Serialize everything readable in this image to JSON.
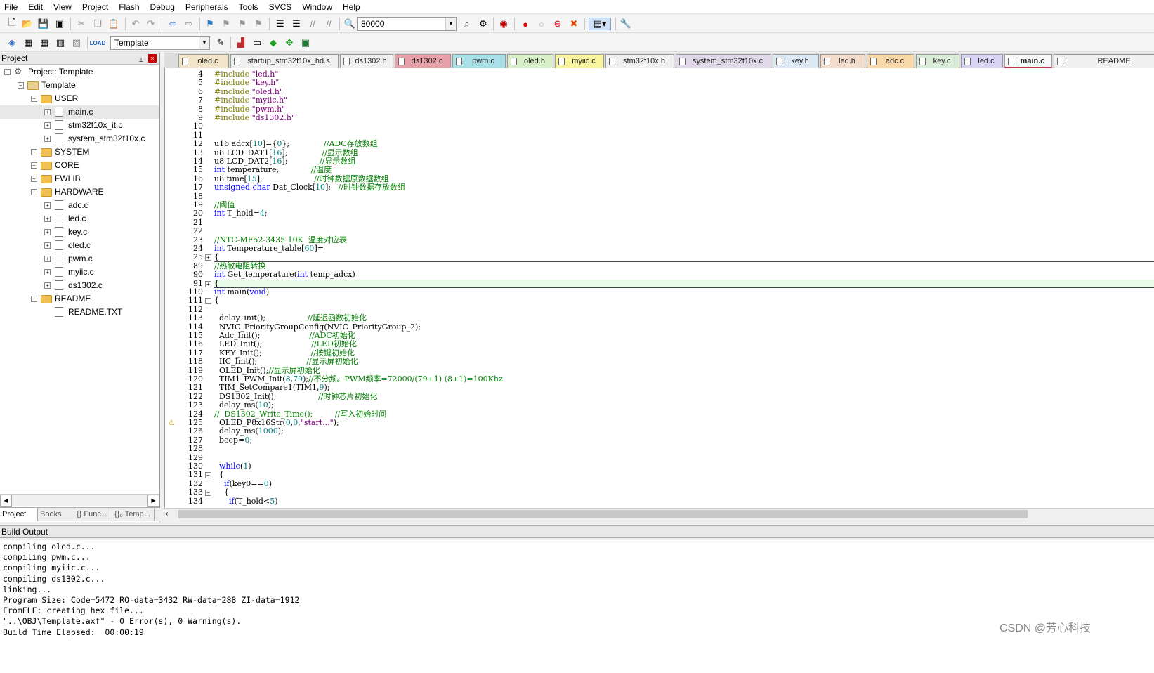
{
  "menu": [
    "File",
    "Edit",
    "View",
    "Project",
    "Flash",
    "Debug",
    "Peripherals",
    "Tools",
    "SVCS",
    "Window",
    "Help"
  ],
  "toolbar": {
    "find_value": "80000",
    "target": "Template"
  },
  "project_panel": {
    "title": "Project",
    "pin": "⊥",
    "close": "×",
    "tree": [
      {
        "label": "Project: Template",
        "depth": 0,
        "exp": "−",
        "kind": "proj"
      },
      {
        "label": "Template",
        "depth": 1,
        "exp": "−",
        "kind": "target"
      },
      {
        "label": "USER",
        "depth": 2,
        "exp": "−",
        "kind": "folder"
      },
      {
        "label": "main.c",
        "depth": 3,
        "exp": "+",
        "kind": "file",
        "sel": true
      },
      {
        "label": "stm32f10x_it.c",
        "depth": 3,
        "exp": "+",
        "kind": "file"
      },
      {
        "label": "system_stm32f10x.c",
        "depth": 3,
        "exp": "+",
        "kind": "file"
      },
      {
        "label": "SYSTEM",
        "depth": 2,
        "exp": "+",
        "kind": "folder"
      },
      {
        "label": "CORE",
        "depth": 2,
        "exp": "+",
        "kind": "folder"
      },
      {
        "label": "FWLIB",
        "depth": 2,
        "exp": "+",
        "kind": "folder"
      },
      {
        "label": "HARDWARE",
        "depth": 2,
        "exp": "−",
        "kind": "folder"
      },
      {
        "label": "adc.c",
        "depth": 3,
        "exp": "+",
        "kind": "file"
      },
      {
        "label": "led.c",
        "depth": 3,
        "exp": "+",
        "kind": "file"
      },
      {
        "label": "key.c",
        "depth": 3,
        "exp": "+",
        "kind": "file"
      },
      {
        "label": "oled.c",
        "depth": 3,
        "exp": "+",
        "kind": "file"
      },
      {
        "label": "pwm.c",
        "depth": 3,
        "exp": "+",
        "kind": "file"
      },
      {
        "label": "myiic.c",
        "depth": 3,
        "exp": "+",
        "kind": "file"
      },
      {
        "label": "ds1302.c",
        "depth": 3,
        "exp": "+",
        "kind": "file"
      },
      {
        "label": "README",
        "depth": 2,
        "exp": "−",
        "kind": "folder"
      },
      {
        "label": "README.TXT",
        "depth": 3,
        "exp": "",
        "kind": "file"
      }
    ],
    "bottom_tabs": [
      "Project",
      "Books",
      "{} Func...",
      "{}₀ Temp..."
    ]
  },
  "tabs": [
    {
      "label": "oled.c",
      "color": "#f2e4c8"
    },
    {
      "label": "startup_stm32f10x_hd.s",
      "color": "#f0f0f0"
    },
    {
      "label": "ds1302.h",
      "color": "#f0f0f0"
    },
    {
      "label": "ds1302.c",
      "color": "#e8a0a8"
    },
    {
      "label": "pwm.c",
      "color": "#a8e0e8"
    },
    {
      "label": "oled.h",
      "color": "#d8f0c8"
    },
    {
      "label": "myiic.c",
      "color": "#f8f4a0"
    },
    {
      "label": "stm32f10x.h",
      "color": "#f0f0f0"
    },
    {
      "label": "system_stm32f10x.c",
      "color": "#e0d8e8"
    },
    {
      "label": "key.h",
      "color": "#dce8f4"
    },
    {
      "label": "led.h",
      "color": "#f4dccc"
    },
    {
      "label": "adc.c",
      "color": "#f8d8a8"
    },
    {
      "label": "key.c",
      "color": "#d8ecd8"
    },
    {
      "label": "led.c",
      "color": "#d8d4f4"
    },
    {
      "label": "main.c",
      "color": "#f8f8f8",
      "active": true
    },
    {
      "label": "README",
      "color": "#f0f0f0"
    }
  ],
  "code": [
    {
      "ln": "4",
      "segs": [
        [
          "pp",
          "#include "
        ],
        [
          "st",
          "\"led.h\""
        ]
      ]
    },
    {
      "ln": "5",
      "segs": [
        [
          "pp",
          "#include "
        ],
        [
          "st",
          "\"key.h\""
        ]
      ]
    },
    {
      "ln": "6",
      "segs": [
        [
          "pp",
          "#include "
        ],
        [
          "st",
          "\"oled.h\""
        ]
      ]
    },
    {
      "ln": "7",
      "segs": [
        [
          "pp",
          "#include "
        ],
        [
          "st",
          "\"myiic.h\""
        ]
      ]
    },
    {
      "ln": "8",
      "segs": [
        [
          "pp",
          "#include "
        ],
        [
          "st",
          "\"pwm.h\""
        ]
      ]
    },
    {
      "ln": "9",
      "segs": [
        [
          "pp",
          "#include "
        ],
        [
          "st",
          "\"ds1302.h\""
        ]
      ]
    },
    {
      "ln": "10",
      "segs": []
    },
    {
      "ln": "11",
      "segs": []
    },
    {
      "ln": "12",
      "segs": [
        [
          "",
          "u16 adcx["
        ],
        [
          "nm",
          "10"
        ],
        [
          "",
          "]={"
        ],
        [
          "nm",
          "0"
        ],
        [
          "",
          "};              "
        ],
        [
          "cm",
          "//ADC存放数组"
        ]
      ]
    },
    {
      "ln": "13",
      "segs": [
        [
          "",
          "u8 LCD_DAT1["
        ],
        [
          "nm",
          "16"
        ],
        [
          "",
          "];              "
        ],
        [
          "cm",
          "//显示数组"
        ]
      ]
    },
    {
      "ln": "14",
      "segs": [
        [
          "",
          "u8 LCD_DAT2["
        ],
        [
          "nm",
          "16"
        ],
        [
          "",
          "];             "
        ],
        [
          "cm",
          "//显示数组"
        ]
      ]
    },
    {
      "ln": "15",
      "segs": [
        [
          "kw",
          "int"
        ],
        [
          "",
          " temperature;             "
        ],
        [
          "cm",
          "//温度"
        ]
      ]
    },
    {
      "ln": "16",
      "segs": [
        [
          "",
          "u8 time["
        ],
        [
          "nm",
          "15"
        ],
        [
          "",
          "];                     "
        ],
        [
          "cm",
          "//时钟数据原数据数组"
        ]
      ]
    },
    {
      "ln": "17",
      "segs": [
        [
          "kw",
          "unsigned"
        ],
        [
          "",
          " "
        ],
        [
          "kw",
          "char"
        ],
        [
          "",
          " Dat_Clock["
        ],
        [
          "nm",
          "10"
        ],
        [
          "",
          "];   "
        ],
        [
          "cm",
          "//时钟数据存放数组"
        ]
      ]
    },
    {
      "ln": "18",
      "segs": []
    },
    {
      "ln": "19",
      "segs": [
        [
          "cm",
          "//阈值"
        ]
      ]
    },
    {
      "ln": "20",
      "segs": [
        [
          "kw",
          "int"
        ],
        [
          "",
          " T_hold="
        ],
        [
          "nm",
          "4"
        ],
        [
          "",
          ";"
        ]
      ]
    },
    {
      "ln": "21",
      "segs": []
    },
    {
      "ln": "22",
      "segs": []
    },
    {
      "ln": "23",
      "segs": [
        [
          "cm",
          "//NTC-MF52-3435 10K  温度对应表"
        ]
      ]
    },
    {
      "ln": "24",
      "segs": [
        [
          "kw",
          "int"
        ],
        [
          "",
          " Temperature_table["
        ],
        [
          "nm",
          "60"
        ],
        [
          "",
          "]="
        ]
      ]
    },
    {
      "ln": "25",
      "segs": [
        [
          "",
          "{"
        ]
      ],
      "fold": "+",
      "box": true
    },
    {
      "ln": "89",
      "segs": [
        [
          "cm",
          "//热敏电阻转换"
        ]
      ]
    },
    {
      "ln": "90",
      "segs": [
        [
          "kw",
          "int"
        ],
        [
          "",
          " Get_temperature("
        ],
        [
          "kw",
          "int"
        ],
        [
          "",
          " temp_adcx)"
        ]
      ]
    },
    {
      "ln": "91",
      "segs": [
        [
          "",
          "{"
        ]
      ],
      "fold": "+",
      "box": true,
      "cur": true
    },
    {
      "ln": "110",
      "segs": [
        [
          "kw",
          "int"
        ],
        [
          "",
          " main("
        ],
        [
          "kw",
          "void"
        ],
        [
          "",
          ")"
        ]
      ]
    },
    {
      "ln": "111",
      "segs": [
        [
          "",
          "{"
        ]
      ],
      "fold": "−"
    },
    {
      "ln": "112",
      "segs": []
    },
    {
      "ln": "113",
      "segs": [
        [
          "",
          "  delay_init();                 "
        ],
        [
          "cm",
          "//延迟函数初始化"
        ]
      ]
    },
    {
      "ln": "114",
      "segs": [
        [
          "",
          "  NVIC_PriorityGroupConfig(NVIC_PriorityGroup_2);"
        ]
      ]
    },
    {
      "ln": "115",
      "segs": [
        [
          "",
          "  Adc_Init();                    "
        ],
        [
          "cm",
          "//ADC初始化"
        ]
      ]
    },
    {
      "ln": "116",
      "segs": [
        [
          "",
          "  LED_Init();                    "
        ],
        [
          "cm",
          "//LED初始化"
        ]
      ]
    },
    {
      "ln": "117",
      "segs": [
        [
          "",
          "  KEY_Init();                    "
        ],
        [
          "cm",
          "//按键初始化"
        ]
      ]
    },
    {
      "ln": "118",
      "segs": [
        [
          "",
          "  IIC_Init();                    "
        ],
        [
          "cm",
          "//显示屏初始化"
        ]
      ]
    },
    {
      "ln": "119",
      "segs": [
        [
          "",
          "  OLED_Init();"
        ],
        [
          "cm",
          "//显示屏初始化"
        ]
      ]
    },
    {
      "ln": "120",
      "segs": [
        [
          "",
          "  TIM1_PWM_Init("
        ],
        [
          "nm",
          "8"
        ],
        [
          "",
          ","
        ],
        [
          "nm",
          "79"
        ],
        [
          "",
          ");"
        ],
        [
          "cm",
          "//不分频。PWM频率=72000/(79+1) (8+1)=100Khz"
        ]
      ]
    },
    {
      "ln": "121",
      "segs": [
        [
          "",
          "  TIM_SetCompare1(TIM1,"
        ],
        [
          "nm",
          "9"
        ],
        [
          "",
          ");"
        ]
      ]
    },
    {
      "ln": "122",
      "segs": [
        [
          "",
          "  DS1302_Init();                 "
        ],
        [
          "cm",
          "//时钟芯片初始化"
        ]
      ]
    },
    {
      "ln": "123",
      "segs": [
        [
          "",
          "  delay_ms("
        ],
        [
          "nm",
          "10"
        ],
        [
          "",
          ");"
        ]
      ]
    },
    {
      "ln": "124",
      "segs": [
        [
          "cm",
          "//  DS1302_Write_Time();         //写入初始时间"
        ]
      ]
    },
    {
      "ln": "125",
      "segs": [
        [
          "",
          "  OLED_P8x16Str("
        ],
        [
          "nm",
          "0"
        ],
        [
          "",
          ","
        ],
        [
          "nm",
          "0"
        ],
        [
          "",
          ","
        ],
        [
          "st",
          "\"start...\""
        ],
        [
          "",
          ");"
        ]
      ],
      "warn": true
    },
    {
      "ln": "126",
      "segs": [
        [
          "",
          "  delay_ms("
        ],
        [
          "nm",
          "1000"
        ],
        [
          "",
          ");"
        ]
      ]
    },
    {
      "ln": "127",
      "segs": [
        [
          "",
          "  beep="
        ],
        [
          "nm",
          "0"
        ],
        [
          "",
          ";"
        ]
      ]
    },
    {
      "ln": "128",
      "segs": []
    },
    {
      "ln": "129",
      "segs": []
    },
    {
      "ln": "130",
      "segs": [
        [
          "",
          "  "
        ],
        [
          "kw",
          "while"
        ],
        [
          "",
          "("
        ],
        [
          "nm",
          "1"
        ],
        [
          "",
          ")"
        ]
      ]
    },
    {
      "ln": "131",
      "segs": [
        [
          "",
          "  {"
        ]
      ],
      "fold": "−"
    },
    {
      "ln": "132",
      "segs": [
        [
          "",
          "    "
        ],
        [
          "kw",
          "if"
        ],
        [
          "",
          "(key0=="
        ],
        [
          "nm",
          "0"
        ],
        [
          "",
          ")"
        ]
      ]
    },
    {
      "ln": "133",
      "segs": [
        [
          "",
          "    {"
        ]
      ],
      "fold": "−"
    },
    {
      "ln": "134",
      "segs": [
        [
          "",
          "      "
        ],
        [
          "kw",
          "if"
        ],
        [
          "",
          "(T_hold<"
        ],
        [
          "nm",
          "5"
        ],
        [
          "",
          ")"
        ]
      ]
    }
  ],
  "build_output": {
    "title": "Build Output",
    "lines": [
      "compiling oled.c...",
      "compiling pwm.c...",
      "compiling myiic.c...",
      "compiling ds1302.c...",
      "linking...",
      "Program Size: Code=5472 RO-data=3432 RW-data=288 ZI-data=1912",
      "FromELF: creating hex file...",
      "\"..\\OBJ\\Template.axf\" - 0 Error(s), 0 Warning(s).",
      "Build Time Elapsed:  00:00:19"
    ]
  },
  "watermark": "CSDN @芳心科技"
}
